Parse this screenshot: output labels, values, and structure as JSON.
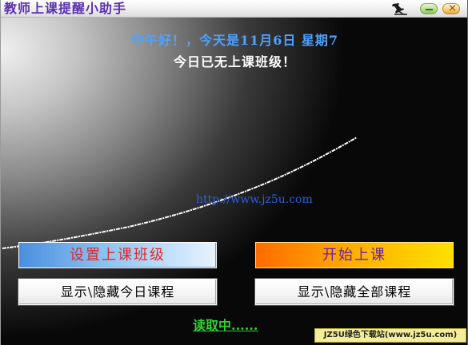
{
  "window": {
    "title": "教师上课提醒小助手"
  },
  "header": {
    "greeting": "中午好！，今天是11月6日 星期7",
    "status": "今日已无上课班级！"
  },
  "link": {
    "url_text": "http://www.jz5u.com"
  },
  "buttons": {
    "setup_label": "设置上课班级",
    "start_label": "开始上课",
    "toggle_today_label": "显示\\隐藏今日课程",
    "toggle_all_label": "显示\\隐藏全部课程"
  },
  "footer": {
    "loading_text": "读取中......",
    "watermark_text": "JZ5U绿色下载站(www.jz5u.com)"
  },
  "colors": {
    "title": "#5a2fb0",
    "greeting": "#4ea2ff",
    "setup_text": "#e0282a",
    "start_text": "#6a1fb0",
    "loading": "#30d030"
  },
  "icons": {
    "pin": "pushpin-icon",
    "minimize": "minimize-icon",
    "close": "close-icon"
  }
}
